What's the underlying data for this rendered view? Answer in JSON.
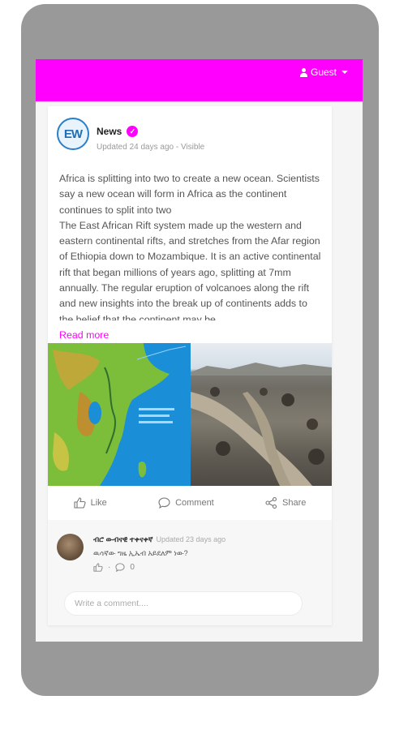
{
  "header": {
    "user_label": "Guest"
  },
  "post": {
    "logo_text": "EW",
    "author": "News",
    "verified_glyph": "✓",
    "meta": "Updated 24 days ago - Visible",
    "text": "Africa is splitting into two to create a new ocean. Scientists say a new ocean will form in Africa as the continent continues to split into two\nThe East African Rift system made up the western and eastern continental rifts, and stretches from the Afar region of Ethiopia down to Mozambique. It is an active continental rift that began millions of years ago, splitting at 7mm annually. The regular eruption of volcanoes along the rift and new insights into the break up of continents adds to the belief that the continent may be",
    "read_more": "Read more",
    "actions": {
      "like": "Like",
      "comment": "Comment",
      "share": "Share"
    }
  },
  "comment": {
    "name": "ብሮ ውብናዊ ተቀናቀኛ",
    "time": "Updated 23 days ago",
    "text": "ዉሳኛው ግዜ ኢኤብ አይደለም ነው?",
    "reply_count": "0",
    "input_placeholder": "Write a comment...."
  },
  "colors": {
    "brand": "#ff00ff",
    "device": "#999999"
  }
}
